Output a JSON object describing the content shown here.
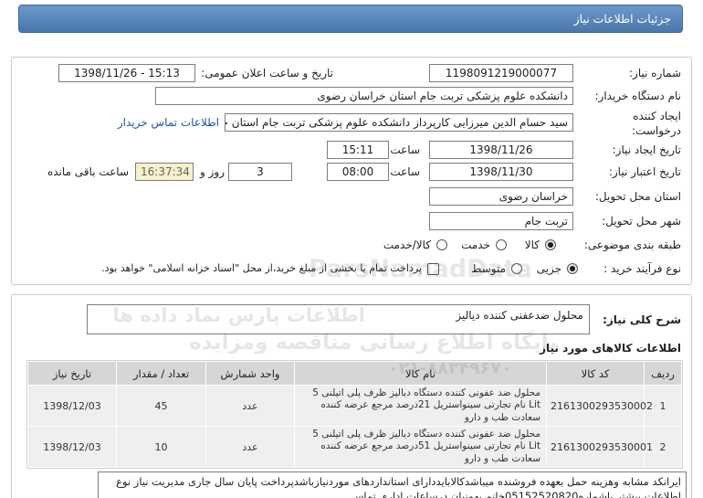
{
  "header": {
    "title": "جزئیات اطلاعات نیاز"
  },
  "colors": {
    "header_top": "#6d99ca",
    "header_bottom": "#4a77ac",
    "link": "#1d56a5",
    "remaining_bg": "#f6f1cc"
  },
  "form": {
    "need_number": {
      "label": "شماره نیاز:",
      "value": "1198091219000077"
    },
    "announce_datetime": {
      "label": "تاریخ و ساعت اعلان عمومی:",
      "value": "1398/11/26 - 15:13"
    },
    "buyer_org": {
      "label": "نام دستگاه خریدار:",
      "value": "دانشکده علوم پزشکی تربت جام استان خراسان رضوی"
    },
    "creator": {
      "label_line1": "ایجاد کننده",
      "label_line2": "درخواست:",
      "value": "سید حسام الدین میرزایی کارپرداز دانشکده علوم پزشکی تربت جام استان خراس",
      "contact_link": "اطلاعات تماس خریدار"
    },
    "created": {
      "label": "تاریخ ایجاد نیاز:",
      "date": "1398/11/26",
      "time_label": "ساعت",
      "time": "15:11"
    },
    "validity": {
      "label": "تاریخ اعتبار نیاز:",
      "date": "1398/11/30",
      "time_label": "ساعت",
      "time": "08:00",
      "days": "3",
      "days_label": "روز و",
      "remaining_time": "16:37:34",
      "remaining_label": "ساعت باقی مانده"
    },
    "province": {
      "label": "استان محل تحویل:",
      "value": "خراسان رضوی"
    },
    "city": {
      "label": "شهر محل تحویل:",
      "value": "تربت جام"
    },
    "category": {
      "label": "طبقه بندی موضوعی:",
      "options": [
        {
          "label": "کالا",
          "checked": true
        },
        {
          "label": "خدمت",
          "checked": false
        },
        {
          "label": "کالا/خدمت",
          "checked": false
        }
      ]
    },
    "process": {
      "label": "نوع فرآیند خرید :",
      "options": [
        {
          "label": "جزیی",
          "checked": true
        },
        {
          "label": "متوسط",
          "checked": false
        }
      ],
      "treasury": {
        "label": "پرداخت تمام یا بخشی از مبلغ خرید،از محل \"اسناد خزانه اسلامی\" خواهد بود.",
        "checked": false
      }
    }
  },
  "description": {
    "label": "شرح کلی نیاز:",
    "value": "محلول ضدعفنی کننده دیالیز"
  },
  "items": {
    "title": "اطلاعات کالاهای مورد نیاز",
    "headers": [
      "ردیف",
      "کد کالا",
      "نام کالا",
      "واحد شمارش",
      "تعداد / مقدار",
      "تاریخ نیاز"
    ],
    "rows": [
      {
        "row": "1",
        "code": "2161300293530002",
        "name": "محلول ضد عفونی کننده دستگاه دیالیز ظرف پلی اتیلنی 5 Lit نام تجارتی سینواستریل 21درصد مرجع عرضه کننده سعادت طب و دارو",
        "unit": "عدد",
        "quantity": "45",
        "need_date": "1398/12/03"
      },
      {
        "row": "2",
        "code": "2161300293530001",
        "name": "محلول ضد عفونی کننده دستگاه دیالیز ظرف پلی اتیلنی 5 Lit نام تجارتی سینواستریل 51درصد مرجع عرضه کننده سعادت طب و دارو",
        "unit": "عدد",
        "quantity": "10",
        "need_date": "1398/12/03"
      }
    ]
  },
  "notes": {
    "value": "ایرانکد مشابه وهزینه حمل بعهده فروشنده میباشدکالابایددارای استانداردهای موردنیازباشدپرداخت پایان سال جاری مدیریت نیاز نوع اطلاعات بیشتر باشماره05152520820خانم بهمنیان درساعات اداری تماس"
  },
  "watermark": {
    "brand": "ParsNamadData",
    "line1": "اطلاعات پارس نماد داده ها",
    "line2": "پایگاه اطلاع رسانی مناقصه ومزایده",
    "phone": "۰۲۱-۸۸۳۴۹۶۷۰"
  }
}
